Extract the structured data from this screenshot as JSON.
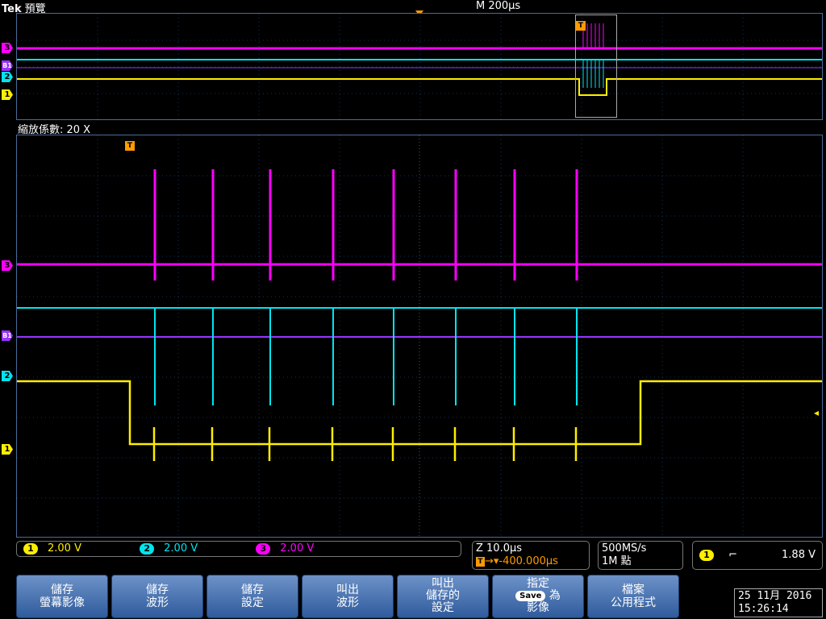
{
  "header": {
    "brand": "Tek",
    "mode_label": "預覽",
    "timebase": "M 200µs"
  },
  "overview": {
    "trigger_marker": "T"
  },
  "zoom": {
    "title": "縮放係數: 20 X",
    "trigger_marker": "T"
  },
  "channel_markers": {
    "ch3": "3",
    "b1": "B1",
    "ch2": "2",
    "ch1": "1"
  },
  "colors": {
    "ch1": "#ffee00",
    "ch2": "#00e5ee",
    "ch3": "#ff00ff",
    "bus": "#9933ff",
    "trigger": "#ff9a00"
  },
  "channels": [
    {
      "id": "1",
      "scale": "2.00 V"
    },
    {
      "id": "2",
      "scale": "2.00 V"
    },
    {
      "id": "3",
      "scale": "2.00 V"
    }
  ],
  "zoom_info": {
    "zoom_scale": "Z 10.0µs",
    "trigger_delay": "-400.000µs"
  },
  "acquisition": {
    "sample_rate": "500MS/s",
    "record_length": "1M 點"
  },
  "trigger": {
    "source": "1",
    "slope_icon": "falling-edge",
    "slope_glyph": "⌐",
    "level": "1.88 V"
  },
  "soft_buttons": [
    {
      "line1": "儲存",
      "line2": "螢幕影像"
    },
    {
      "line1": "儲存",
      "line2": "波形"
    },
    {
      "line1": "儲存",
      "line2": "設定"
    },
    {
      "line1": "叫出",
      "line2": "波形"
    },
    {
      "line1": "叫出",
      "line2": "儲存的",
      "line3": "設定"
    },
    {
      "line1": "指定",
      "save_chip": "Save",
      "line2b": "為",
      "line3": "影像"
    },
    {
      "line1": "檔案",
      "line2": "公用程式"
    }
  ],
  "clock": {
    "date": "25 11月 2016",
    "time": "15:26:14"
  }
}
